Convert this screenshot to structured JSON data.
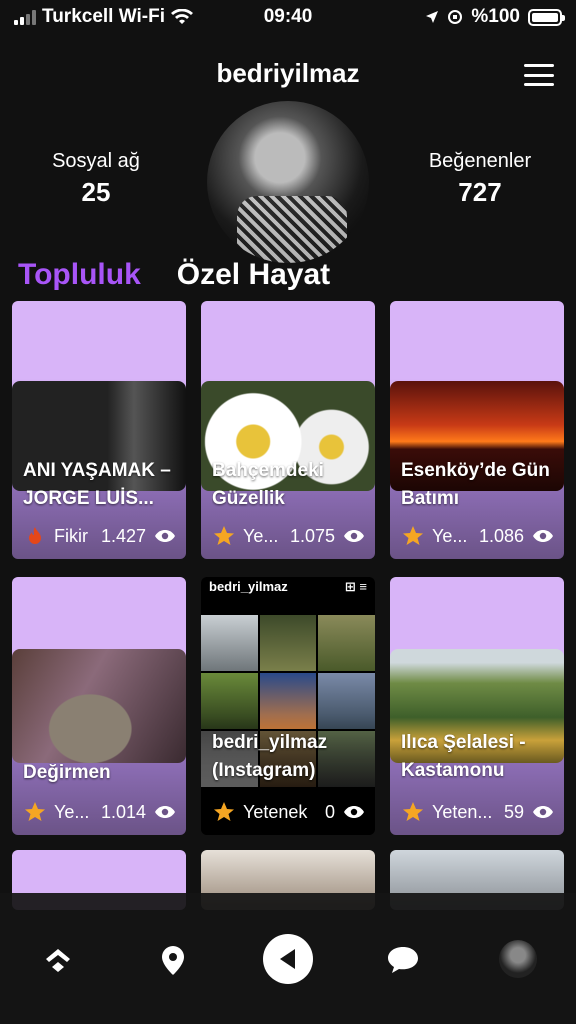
{
  "status_bar": {
    "carrier": "Turkcell Wi-Fi",
    "time": "09:40",
    "battery": "%100"
  },
  "header": {
    "username": "bedriyilmaz"
  },
  "stats": {
    "left": {
      "label": "Sosyal ağ",
      "value": "25"
    },
    "right": {
      "label": "Beğenenler",
      "value": "727"
    }
  },
  "tabs": [
    {
      "label": "Topluluk",
      "active": true
    },
    {
      "label": "Özel Hayat",
      "active": false
    }
  ],
  "cards": [
    {
      "title": "ANI YAŞAMAK – JORGE LUİS...",
      "category": "Fikir",
      "category_icon": "flame-icon",
      "views": "1.427"
    },
    {
      "title": "Bahçemdeki Güzellik",
      "category": "Ye...",
      "category_icon": "star-icon",
      "views": "1.075"
    },
    {
      "title": "Esenköy’de Gün Batımı",
      "category": "Ye...",
      "category_icon": "star-icon",
      "views": "1.086"
    },
    {
      "title": "Değirmen",
      "category": "Ye...",
      "category_icon": "star-icon",
      "views": "1.014"
    },
    {
      "title": "bedri_yilmaz (Instagram)",
      "category": "Yetenek",
      "category_icon": "star-icon",
      "views": "0",
      "insta_handle": "bedri_yilmaz"
    },
    {
      "title": "Ilıca Şelalesi - Kastamonu",
      "category": "Yeten...",
      "category_icon": "star-icon",
      "views": "59"
    }
  ],
  "bottom_nav": [
    {
      "name": "home-nav-icon"
    },
    {
      "name": "location-nav-icon"
    },
    {
      "name": "play-nav-button"
    },
    {
      "name": "chat-nav-icon"
    },
    {
      "name": "profile-nav-avatar"
    }
  ],
  "colors": {
    "accent": "#a855f7",
    "card_top": "#d8b4f8",
    "background": "#111111"
  }
}
